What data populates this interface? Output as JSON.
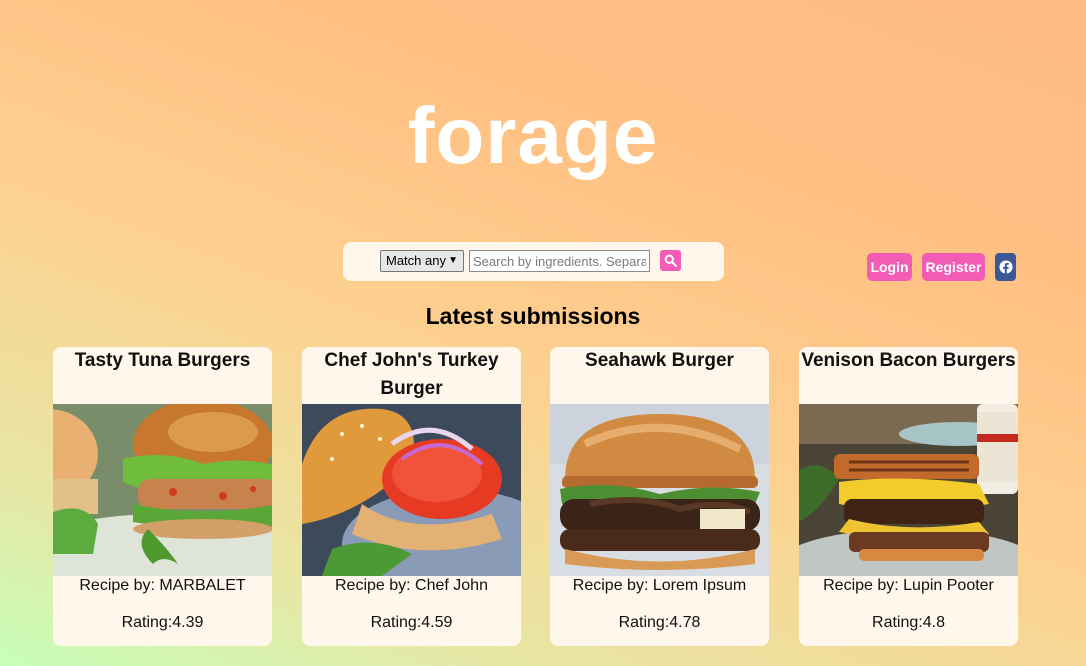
{
  "header": {
    "logo_text": "forage"
  },
  "search": {
    "match_mode": "Match any",
    "placeholder": "Search by ingredients. Separate with commas"
  },
  "auth": {
    "login_label": "Login",
    "register_label": "Register"
  },
  "section": {
    "title": "Latest submissions"
  },
  "recipes": [
    {
      "title": "Tasty Tuna Burgers",
      "author": "Recipe by: MARBALET",
      "rating": "Rating:4.39",
      "image": "tuna-burger-photo"
    },
    {
      "title": "Chef John's Turkey Burger",
      "author": "Recipe by: Chef John",
      "rating": "Rating:4.59",
      "image": "turkey-burger-photo"
    },
    {
      "title": "Seahawk Burger",
      "author": "Recipe by: Lorem Ipsum",
      "rating": "Rating:4.78",
      "image": "seahawk-burger-photo"
    },
    {
      "title": "Venison Bacon Burgers",
      "author": "Recipe by: Lupin Pooter",
      "rating": "Rating:4.8",
      "image": "venison-burger-photo"
    }
  ],
  "colors": {
    "accent": "#f25cb5",
    "facebook": "#3b5998",
    "card_bg": "#fff7eb"
  },
  "icons": {
    "search": "search-icon",
    "facebook": "facebook-icon",
    "dropdown": "chevron-down-icon"
  }
}
